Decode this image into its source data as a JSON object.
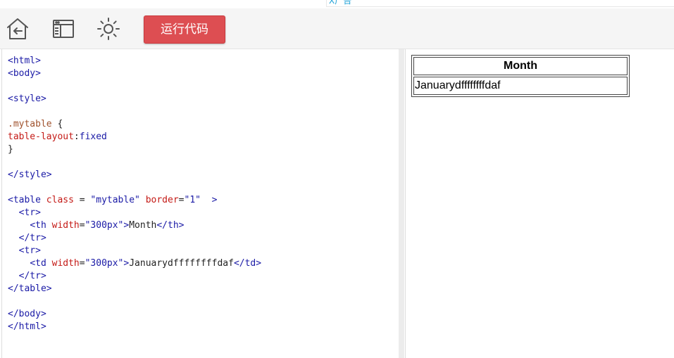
{
  "ad": {
    "label": "X广告"
  },
  "toolbar": {
    "icons": [
      "home-back-icon",
      "layout-window-icon",
      "brightness-sun-icon"
    ],
    "run_label": "运行代码"
  },
  "editor": {
    "lines": [
      [
        {
          "c": "tag",
          "t": "<html>"
        }
      ],
      [
        {
          "c": "tag",
          "t": "<body>"
        }
      ],
      [],
      [
        {
          "c": "tag",
          "t": "<style>"
        }
      ],
      [],
      [
        {
          "c": "sel",
          "t": ".mytable"
        },
        {
          "c": "txt",
          "t": " {"
        }
      ],
      [
        {
          "c": "prop",
          "t": "table-layout"
        },
        {
          "c": "txt",
          "t": ":"
        },
        {
          "c": "val",
          "t": "fixed"
        }
      ],
      [
        {
          "c": "txt",
          "t": "}"
        }
      ],
      [],
      [
        {
          "c": "tag",
          "t": "</style>"
        }
      ],
      [],
      [
        {
          "c": "tag",
          "t": "<table"
        },
        {
          "c": "txt",
          "t": " "
        },
        {
          "c": "attr",
          "t": "class"
        },
        {
          "c": "txt",
          "t": " = "
        },
        {
          "c": "str",
          "t": "\"mytable\""
        },
        {
          "c": "txt",
          "t": " "
        },
        {
          "c": "attr",
          "t": "border"
        },
        {
          "c": "txt",
          "t": "="
        },
        {
          "c": "str",
          "t": "\"1\""
        },
        {
          "c": "txt",
          "t": "  "
        },
        {
          "c": "tag",
          "t": ">"
        }
      ],
      [
        {
          "c": "txt",
          "t": "  "
        },
        {
          "c": "tag",
          "t": "<tr>"
        }
      ],
      [
        {
          "c": "txt",
          "t": "    "
        },
        {
          "c": "tag",
          "t": "<th"
        },
        {
          "c": "txt",
          "t": " "
        },
        {
          "c": "attr",
          "t": "width"
        },
        {
          "c": "txt",
          "t": "="
        },
        {
          "c": "str",
          "t": "\"300px\""
        },
        {
          "c": "tag",
          "t": ">"
        },
        {
          "c": "txt",
          "t": "Month"
        },
        {
          "c": "tag",
          "t": "</th>"
        }
      ],
      [
        {
          "c": "txt",
          "t": "  "
        },
        {
          "c": "tag",
          "t": "</tr>"
        }
      ],
      [
        {
          "c": "txt",
          "t": "  "
        },
        {
          "c": "tag",
          "t": "<tr>"
        }
      ],
      [
        {
          "c": "txt",
          "t": "    "
        },
        {
          "c": "tag",
          "t": "<td"
        },
        {
          "c": "txt",
          "t": " "
        },
        {
          "c": "attr",
          "t": "width"
        },
        {
          "c": "txt",
          "t": "="
        },
        {
          "c": "str",
          "t": "\"300px\""
        },
        {
          "c": "tag",
          "t": ">"
        },
        {
          "c": "txt",
          "t": "Januarydffffffffdaf"
        },
        {
          "c": "tag",
          "t": "</td>"
        }
      ],
      [
        {
          "c": "txt",
          "t": "  "
        },
        {
          "c": "tag",
          "t": "</tr>"
        }
      ],
      [
        {
          "c": "tag",
          "t": "</table>"
        }
      ],
      [],
      [
        {
          "c": "tag",
          "t": "</body>"
        }
      ],
      [
        {
          "c": "tag",
          "t": "</html>"
        }
      ]
    ]
  },
  "preview": {
    "header": "Month",
    "cell": "Januarydffffffffdaf"
  }
}
